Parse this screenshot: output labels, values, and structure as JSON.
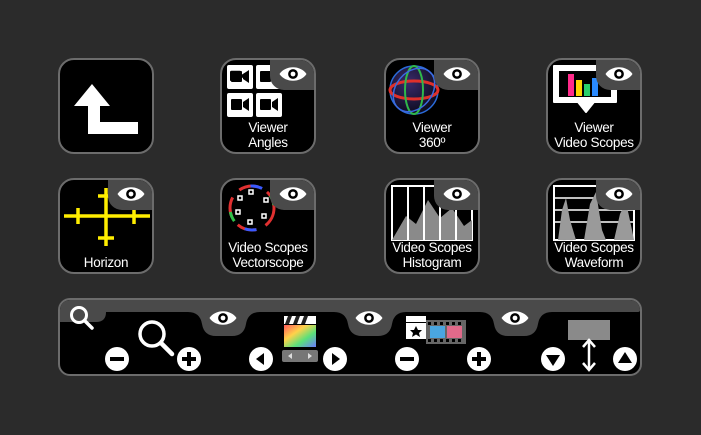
{
  "tiles": {
    "back": {
      "label": ""
    },
    "viewer_angles": {
      "line1": "Viewer",
      "line2": "Angles"
    },
    "viewer_360": {
      "line1": "Viewer",
      "line2": "360º"
    },
    "viewer_video_scopes": {
      "line1": "Viewer",
      "line2": "Video Scopes"
    },
    "horizon": {
      "line1": "Horizon"
    },
    "vectorscope": {
      "line1": "Video Scopes",
      "line2": "Vectorscope"
    },
    "histogram": {
      "line1": "Video Scopes",
      "line2": "Histogram"
    },
    "waveform": {
      "line1": "Video Scopes",
      "line2": "Waveform"
    }
  },
  "icons": {
    "back": "up-left-arrow-icon",
    "eye": "eye-icon",
    "search": "search-icon",
    "zoom": "magnifier-icon",
    "minus": "minus-circle-icon",
    "plus": "plus-circle-icon",
    "left": "left-arrow-circle-icon",
    "right": "right-arrow-circle-icon",
    "down": "down-triangle-circle-icon",
    "up": "up-triangle-circle-icon",
    "clapper": "final-cut-clapperboard-icon",
    "filmstrip": "filmstrip-icon",
    "resize": "vertical-resize-icon"
  },
  "colors": {
    "background": "#2b2b2b",
    "tile": "#000000",
    "tile_border": "#6c6c6c",
    "badge": "#4a4a4a",
    "horizon_yellow": "#ffee00"
  }
}
